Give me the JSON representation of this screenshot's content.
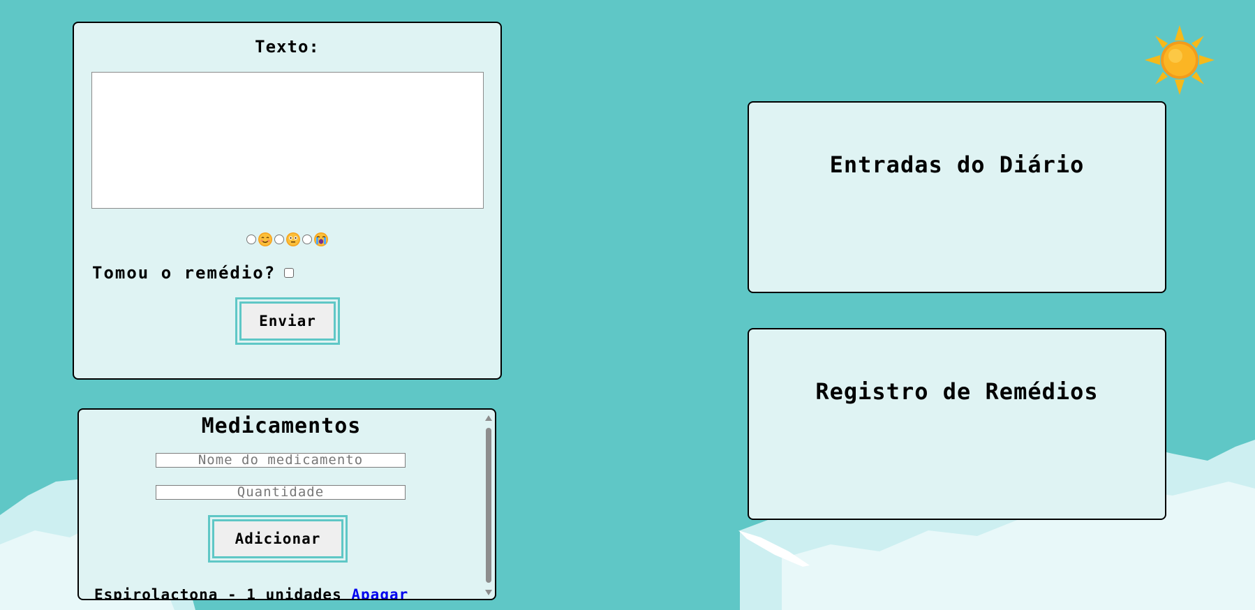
{
  "form": {
    "title": "Texto:",
    "textarea_value": "",
    "moods": [
      {
        "icon": "smiling-face-icon"
      },
      {
        "icon": "flushed-face-icon"
      },
      {
        "icon": "crying-face-icon"
      }
    ],
    "medicine_question": "Tomou o remédio?",
    "medicine_taken": false,
    "submit_label": "Enviar"
  },
  "medications": {
    "title": "Medicamentos",
    "name_placeholder": "Nome do medicamento",
    "quantity_placeholder": "Quantidade",
    "add_label": "Adicionar",
    "items": [
      {
        "text": "Espirolactona - 1 unidades",
        "delete_label": "Apagar"
      }
    ]
  },
  "diary_entries": {
    "title": "Entradas do Diário"
  },
  "medicine_log": {
    "title": "Registro de Remédios"
  },
  "colors": {
    "background": "#5fc7c6",
    "panel": "#dff3f3",
    "accent": "#5fc7c6",
    "link": "#0000ee",
    "sun": "#f9b72a"
  }
}
